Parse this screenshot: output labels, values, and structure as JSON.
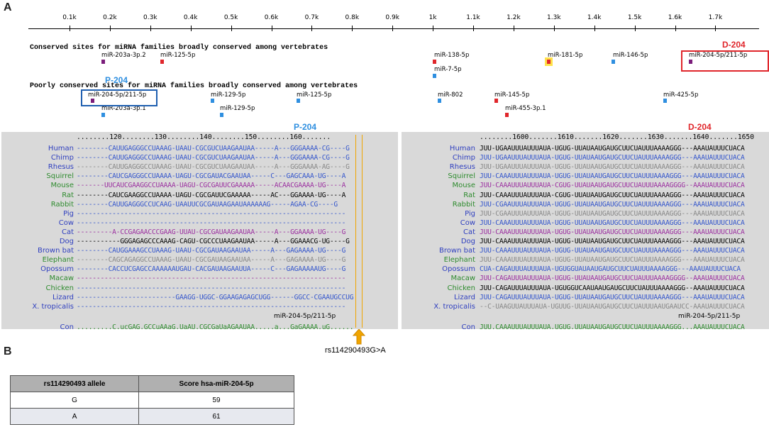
{
  "panels": {
    "a": "A",
    "b": "B"
  },
  "ruler": {
    "ticks": [
      "0.1k",
      "0.2k",
      "0.3k",
      "0.4k",
      "0.5k",
      "0.6k",
      "0.7k",
      "0.8k",
      "0.9k",
      "1k",
      "1.1k",
      "1.2k",
      "1.3k",
      "1.4k",
      "1.5k",
      "1.6k",
      "1.7k"
    ]
  },
  "conserved": {
    "title": "Conserved sites for miRNA families broadly conserved among vertebrates",
    "sites": [
      {
        "label": "miR-203a-3p.2",
        "color": "#7b1d7b"
      },
      {
        "label": "miR-125-5p",
        "color": "#e0262b"
      },
      {
        "label": "miR-138-5p",
        "color": "#e0262b"
      },
      {
        "label": "miR-7-5p",
        "color": "#2f8fe0"
      },
      {
        "label": "miR-181-5p",
        "color": "#e0262b",
        "highlight": "#ffe24a"
      },
      {
        "label": "miR-146-5p",
        "color": "#2f8fe0"
      },
      {
        "label": "miR-204-5p/211-5p",
        "color": "#7b1d7b"
      }
    ]
  },
  "poorly": {
    "title": "Poorly conserved sites for miRNA families broadly conserved among vertebrates",
    "sites": [
      {
        "label": "miR-204-5p/211-5p",
        "color": "#7b1d7b"
      },
      {
        "label": "miR-203a-3p.1",
        "color": "#2f8fe0"
      },
      {
        "label": "miR-129-5p",
        "color": "#2f8fe0"
      },
      {
        "label": "miR-129-5p",
        "color": "#2f8fe0"
      },
      {
        "label": "miR-125-5p",
        "color": "#2f8fe0"
      },
      {
        "label": "miR-802",
        "color": "#2f8fe0"
      },
      {
        "label": "miR-145-5p",
        "color": "#e0262b"
      },
      {
        "label": "miR-455-3p.1",
        "color": "#e0262b"
      },
      {
        "label": "miR-425-5p",
        "color": "#2f8fe0"
      }
    ]
  },
  "labels": {
    "d204": "D-204",
    "p204": "P-204",
    "d204_color": "#e0262b",
    "p204_color": "#2f8fe0"
  },
  "species": [
    {
      "name": "Human",
      "color": "#2f3fbf"
    },
    {
      "name": "Chimp",
      "color": "#2f3fbf"
    },
    {
      "name": "Rhesus",
      "color": "#2f3fbf"
    },
    {
      "name": "Squirrel",
      "color": "#2e8b2e"
    },
    {
      "name": "Mouse",
      "color": "#2e8b2e"
    },
    {
      "name": "Rat",
      "color": "#2e8b2e"
    },
    {
      "name": "Rabbit",
      "color": "#2e8b2e"
    },
    {
      "name": "Pig",
      "color": "#2f3fbf"
    },
    {
      "name": "Cow",
      "color": "#2f3fbf"
    },
    {
      "name": "Cat",
      "color": "#2f3fbf"
    },
    {
      "name": "Dog",
      "color": "#2f3fbf"
    },
    {
      "name": "Brown bat",
      "color": "#2f3fbf"
    },
    {
      "name": "Elephant",
      "color": "#2e8b2e"
    },
    {
      "name": "Opossum",
      "color": "#2f3fbf"
    },
    {
      "name": "Macaw",
      "color": "#2e8b2e"
    },
    {
      "name": "Chicken",
      "color": "#2e8b2e"
    },
    {
      "name": "Lizard",
      "color": "#2f3fbf"
    },
    {
      "name": "X. tropicalis",
      "color": "#2f3fbf"
    }
  ],
  "alignment_left": {
    "coords": "........120........130........140........150........160.......",
    "rows": [
      {
        "seq": "--------CAUUGAGGGCCUAAAG-UAAU-CGCGUCUAAGAAUAA-----A---GGGAAAA-CG----G",
        "color": "#3355cc"
      },
      {
        "seq": "--------CAUUGAGGGCCUAAAG-UAAU-CGCGUCUAAGAAUAA-----A---GGGAAAA-CG----G",
        "color": "#3355cc"
      },
      {
        "seq": "--------CAUUGAGGGCCUAAAG-UAAU-CGCGUCUAAGAAUAA-----A---GGGAAAA-AG----G",
        "color": "#888888"
      },
      {
        "seq": "--------CAUCGAGGGCCUAAAA-UAGU-CGCGAUACGAAUAA-----C---GAGCAAA-UG----A",
        "color": "#3355cc"
      },
      {
        "seq": "-------UUCAUCGAAGGCCUAAAA-UAGU-CGCGAUUCGAAAAA-----ACAACGAAAA-UG----A",
        "color": "#9b2fa0"
      },
      {
        "seq": "--------CAUCGAAGGCCUAAAA-UAGU-CGCGAUUCGAAAAA-----AC---GGAAAA-UG----A",
        "color": "#000000"
      },
      {
        "seq": "--------CAUUGAGGGCCUCAAG-UAAUUCGCGAUAAGAAUAAAAAAG-----AGAA-CG----G",
        "color": "#3355cc"
      },
      {
        "seq": "--------------------------------------------------------------------",
        "color": "#3355cc"
      },
      {
        "seq": "--------------------------------------------------------------------",
        "color": "#3355cc"
      },
      {
        "seq": "---------A-CCGAGAACCCGAAG-UUAU-CGCGAUAAGAAUAA-----A---GGAAAA-UG----G",
        "color": "#9b2fa0"
      },
      {
        "seq": "-----------GGGAGAGCCCAAAG-CAGU-CGCCCUAAGAAUAA-----A---GGAAACG-UG----G",
        "color": "#000000"
      },
      {
        "seq": "--------CAUGGAAAGCCUAAAG-UAAU-CGCGAUAAGAAUAA-----A---GAGAAAA-UG----G",
        "color": "#3355cc"
      },
      {
        "seq": "--------CAGCAGAGGCCUAAAG-UAAU-CGCGAUAAGAAUAA-----A---GAGAAAA-UG----G",
        "color": "#888888"
      },
      {
        "seq": "--------CACCUCGAGCCAAAAAAUGAU-CACGAUAAGAAUUA-----C---GAGAAAAAUG----G",
        "color": "#3355cc"
      },
      {
        "seq": "--------------------------------------------------------------------",
        "color": "#9b2fa0"
      },
      {
        "seq": "--------------------------------------------------------------------",
        "color": "#3355cc"
      },
      {
        "seq": "-------------------------GAAGG-UGGC-GGAAGAGAGCUGG------GGCC-CGAAUGCCUG",
        "color": "#3355cc"
      },
      {
        "seq": "--------------------------------------------------------------------",
        "color": "#3355cc"
      }
    ],
    "mirna": "miR-204-5p/211-5p",
    "con": ".........C.ucGAG.GCCuAAaG.UaAU.CGCGaUaAGAAUAA.....a...GaGAAAA.uG......",
    "con_label": "Con"
  },
  "alignment_right": {
    "coords": "........1600.......1610.......1620.......1630.......1640.......1650",
    "rows": [
      {
        "seq": "JUU-UGAAUUUAUUUAUA-UGUG-UUAUAAUGAUGCUUCUAUUUAAAAGGG---AAAUAUUUCUACA",
        "color": "#000000"
      },
      {
        "seq": "JUU-UGAAUUUAUUUAUA-UGUG-UUAUAAUGAUGCUUCUAUUUAAAAGGG---AAAUAUUUCUACA",
        "color": "#3355cc"
      },
      {
        "seq": "JUU-UGAAUUUAUUUAUA-UGUG-UUAUAAUGAUGCUUCUAUUUAAAAGGG---AAAUAUUUCUACA",
        "color": "#888888"
      },
      {
        "seq": "JUU-CAAAUUUAUUUAUA-UGUG-UUAUAAUGAUGCUUCUAUUUAAAAGGG---AAAUAUUUCUACA",
        "color": "#3355cc"
      },
      {
        "seq": "JUU-CAAAUUUAUUUAUA-CGUG-UUAUAAUGAUGCUUCUAUUUAAAAGGGG--AAAUAUUUCUACA",
        "color": "#9b2fa0"
      },
      {
        "seq": "JUU-CAAAUUUAUUUAUA-CGUG-UUAUAAUGAUGCUUCUAUUUAAAAGGG---AAAUAUUUCUACA",
        "color": "#000000"
      },
      {
        "seq": "JUU-CGAAUUUAUUUAUA-UGUG-UUAUAAUGAUGCUUCUAUUUAAAAGGG---AAAUAUUUCUACA",
        "color": "#3355cc"
      },
      {
        "seq": "JUU-CGAAUUUAUUUAUA-UGUG-UUAUAAUGAUGCUUCUAUUUAAAAGGG---AAAUAUUUCUACA",
        "color": "#888888"
      },
      {
        "seq": "JUU-CAAAUUUAUUUAUA-UGUG-UUAUAAUGAUGCUUCUAUUUAAAAGGG---AAAUAUUUCUACA",
        "color": "#3355cc"
      },
      {
        "seq": "JUU-CAAAUUUAUUUAUA-UGUG-UUAUAAUGAUGCUUCUAUUUAAAAGGG---AAAUAUUUCUACA",
        "color": "#9b2fa0"
      },
      {
        "seq": "JUU-CAAAUUUAUUUAUA-UGUG-UUAUAAUGAUGCUUCUAUUUAAAAGGG---AAAUAUUUCUACA",
        "color": "#000000"
      },
      {
        "seq": "JUU-CAAAUUUAUUUAUA-UGUG-UUAUAAUGAUGCUUCUAUUUAAAAGGG---AAAUAUUUCUACA",
        "color": "#3355cc"
      },
      {
        "seq": "JUU-CAAAUUUAUUUAUA-UGUG-UUAUAAUGAUGCUUCUAUUUAAAAGGG---AAAUAUUUCUACA",
        "color": "#888888"
      },
      {
        "seq": "CUA-CAGAUUUAUUUAUA-UGUGGUAUAAUGAUGCUUCUAUUUAAAAGGG---AAAUAUUUCUACA",
        "color": "#3355cc"
      },
      {
        "seq": "JUU-CAGAUUUAUUUAUA-UGUG-UUAUAAUGAUGCUUCUAUUUAAAAGGGG--AAAUAUUUCUACA",
        "color": "#9b2fa0"
      },
      {
        "seq": "JUU-CAGAUUUAUUUAUA-UGUGGUCAAUAAUGAUGCUUCUAUUUAAAAGGG--AAAUAUUUCUACA",
        "color": "#000000"
      },
      {
        "seq": "JUU-CAGAUUUAUUUAUA-UGUG-UUAUAAUGAUGCUUCUAUUUAAAAGGG---AAAUAUUUCUACA",
        "color": "#3355cc"
      },
      {
        "seq": "--C-UAAGUUAUUUAUA-UGUUG-UUAUAAUGAUGCUUCUAUUUAAUGAAUCC-AAAUAUUUCUACA",
        "color": "#888888"
      }
    ],
    "mirna": "miR-204-5p/211-5p",
    "con": "JUU.CAAAUUUAUUUAUA.UGUG.UUAUAAUGAUGCUUCUAUUUAAAAGGG...AAAUAUUUCUACA",
    "con_label": "Con"
  },
  "snp": {
    "label": "rs114290493G>A",
    "color": "#f0a500"
  },
  "table": {
    "headers": [
      "rs114290493  allele",
      "Score hsa-miR-204-5p"
    ],
    "rows": [
      [
        "G",
        "59"
      ],
      [
        "A",
        "61"
      ]
    ]
  }
}
